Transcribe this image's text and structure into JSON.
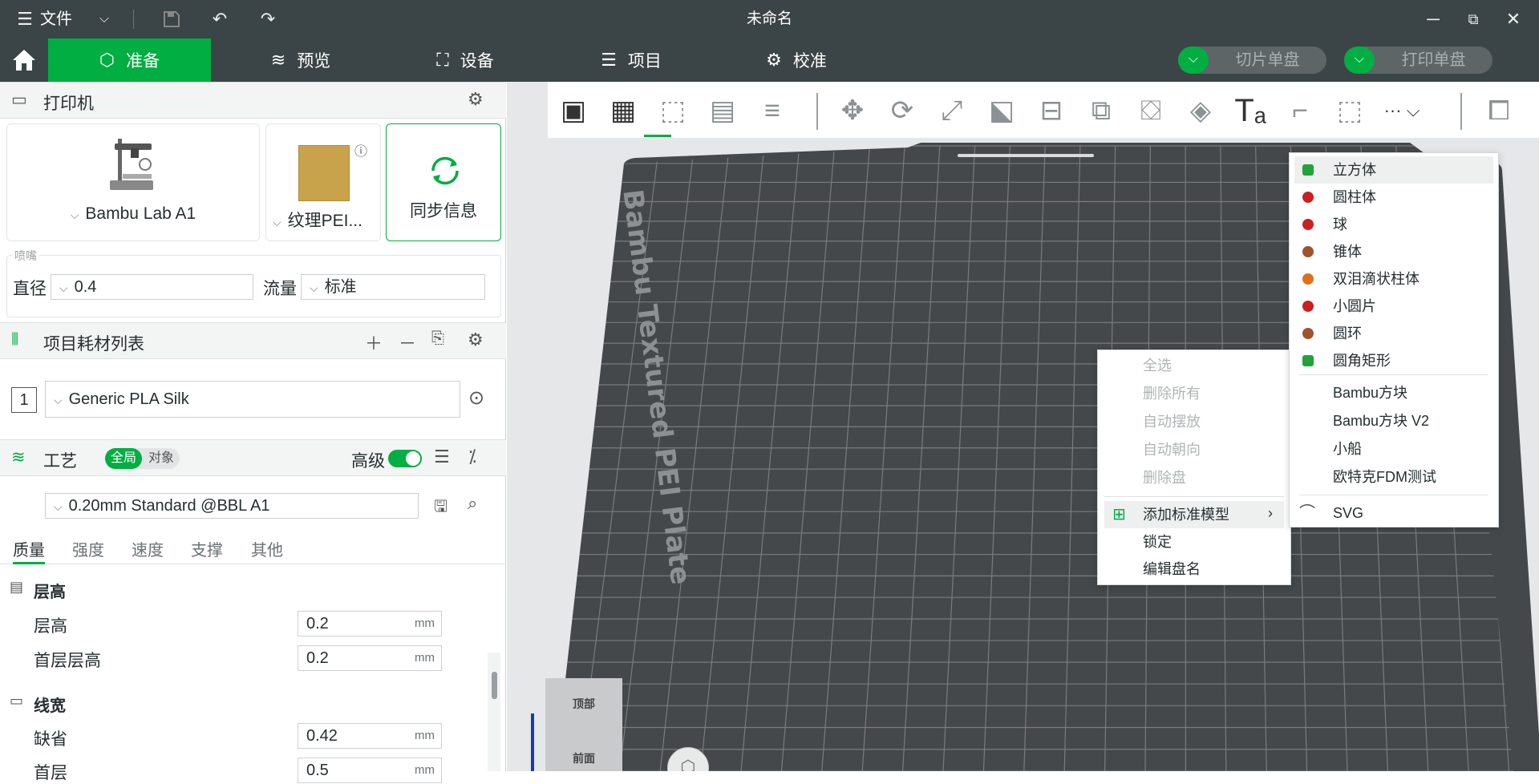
{
  "titlebar": {
    "file_menu": "文件",
    "title": "未命名"
  },
  "nav": {
    "tabs": [
      "准备",
      "预览",
      "设备",
      "项目",
      "校准"
    ],
    "active_tab": "准备",
    "slice_button": "切片单盘",
    "print_button": "打印单盘",
    "accent": "#00ae42"
  },
  "printer": {
    "header": "打印机",
    "printer_name": "Bambu Lab A1",
    "plate_name": "纹理PEI...",
    "sync_label": "同步信息",
    "nozzle_section": "喷嘴",
    "diameter_label": "直径",
    "diameter_value": "0.4",
    "flow_label": "流量",
    "flow_value": "标准"
  },
  "filament": {
    "header": "项目耗材列表",
    "index": "1",
    "name": "Generic PLA Silk"
  },
  "process": {
    "header": "工艺",
    "toggle_global": "全局",
    "toggle_object": "对象",
    "advanced_label": "高级",
    "preset": "0.20mm Standard @BBL A1",
    "tabs": [
      "质量",
      "强度",
      "速度",
      "支撑",
      "其他"
    ],
    "active_tab": "质量",
    "groups": [
      {
        "title": "层高",
        "rows": [
          {
            "label": "层高",
            "value": "0.2",
            "unit": "mm"
          },
          {
            "label": "首层层高",
            "value": "0.2",
            "unit": "mm"
          }
        ]
      },
      {
        "title": "线宽",
        "rows": [
          {
            "label": "缺省",
            "value": "0.42",
            "unit": "mm"
          },
          {
            "label": "首层",
            "value": "0.5",
            "unit": "mm"
          }
        ]
      }
    ]
  },
  "canvas": {
    "plate_label": "Bambu Textured PEI Plate",
    "view_top": "顶部",
    "view_front": "前面",
    "bed_color": "#45484b"
  },
  "context_menu": {
    "items": [
      {
        "label": "全选",
        "disabled": true
      },
      {
        "label": "删除所有",
        "disabled": true
      },
      {
        "label": "自动摆放",
        "disabled": true
      },
      {
        "label": "自动朝向",
        "disabled": true
      },
      {
        "label": "删除盘",
        "disabled": true
      },
      {
        "label": "添加标准模型",
        "disabled": false
      },
      {
        "label": "锁定",
        "disabled": false
      },
      {
        "label": "编辑盘名",
        "disabled": false
      }
    ]
  },
  "submenu": {
    "shapes": [
      {
        "label": "立方体",
        "color": "#1fa33a"
      },
      {
        "label": "圆柱体",
        "color": "#cc1f1f"
      },
      {
        "label": "球",
        "color": "#cc1f1f"
      },
      {
        "label": "锥体",
        "color": "#a0522d"
      },
      {
        "label": "双泪滴状柱体",
        "color": "#e07020"
      },
      {
        "label": "小圆片",
        "color": "#cc1f1f"
      },
      {
        "label": "圆环",
        "color": "#a0522d"
      },
      {
        "label": "圆角矩形",
        "color": "#1fa33a"
      }
    ],
    "models": [
      "Bambu方块",
      "Bambu方块 V2",
      "小船",
      "欧特克FDM测试"
    ],
    "svg_label": "SVG"
  }
}
